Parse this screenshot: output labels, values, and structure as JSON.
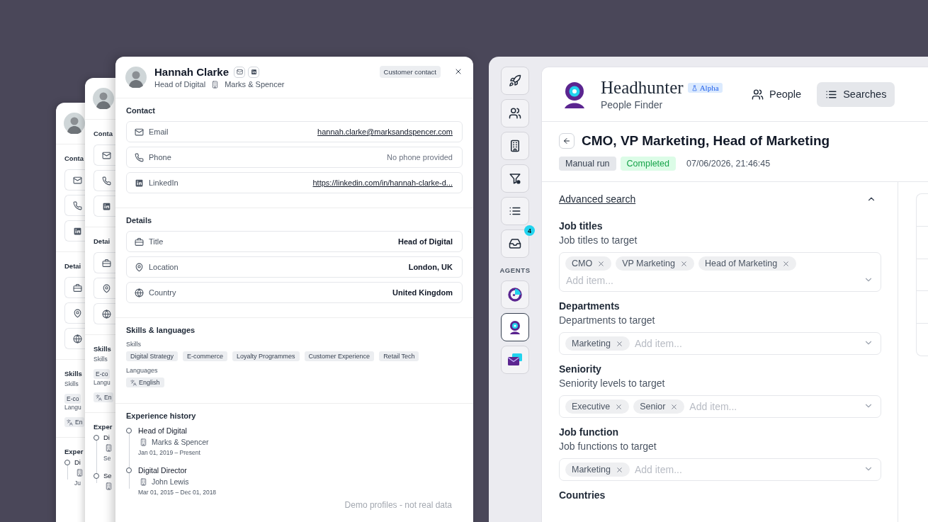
{
  "stacked_profiles": [
    {
      "contact_heading": "Conta",
      "details_heading": "Detai",
      "skills_heading": "Skills",
      "skills_label": "Skills",
      "skill": "E-co",
      "languages_label": "Langu",
      "language": "En",
      "experience_heading": "Exper",
      "experience": [
        {
          "title": "Di",
          "dates": "Ju"
        }
      ]
    },
    {
      "contact_heading": "Conta",
      "details_heading": "Detai",
      "skills_heading": "Skills",
      "skills_label": "Skills",
      "skill": "E-co",
      "languages_label": "Langu",
      "language": "En",
      "experience_heading": "Exper",
      "experience": [
        {
          "title": "Di",
          "dates": "Se"
        },
        {
          "title": "Se"
        }
      ]
    }
  ],
  "profile": {
    "name": "Hannah Clarke",
    "title": "Head of Digital",
    "company": "Marks & Spencer",
    "badge": "Customer contact",
    "sections": [
      {
        "heading": "Contact",
        "rows": [
          {
            "label": "Email",
            "value": "hannah.clarke@marksandspencer.com",
            "kind": "link"
          },
          {
            "label": "Phone",
            "value": "No phone provided",
            "kind": "empty"
          },
          {
            "label": "LinkedIn",
            "value": "https://linkedin.com/in/hannah-clarke-d...",
            "kind": "link"
          }
        ]
      },
      {
        "heading": "Details",
        "rows": [
          {
            "label": "Title",
            "value": "Head of Digital",
            "kind": "text"
          },
          {
            "label": "Location",
            "value": "London, UK",
            "kind": "text"
          },
          {
            "label": "Country",
            "value": "United Kingdom",
            "kind": "text"
          }
        ]
      }
    ],
    "skills": {
      "heading": "Skills & languages",
      "skills_label": "Skills",
      "skills": [
        "Digital Strategy",
        "E-commerce",
        "Loyalty Programmes",
        "Customer Experience",
        "Retail Tech"
      ],
      "languages_label": "Languages",
      "languages": [
        "English"
      ]
    },
    "experience": {
      "heading": "Experience history",
      "items": [
        {
          "title": "Head of Digital",
          "company": "Marks & Spencer",
          "dates": "Jan 01, 2019 – Present"
        },
        {
          "title": "Digital Director",
          "company": "John Lewis",
          "dates": "Mar 01, 2015 – Dec 01, 2018"
        }
      ]
    },
    "footnote": "Demo profiles - not real data"
  },
  "app": {
    "rail": {
      "tools": [
        {
          "selected": false
        },
        {
          "selected": false
        },
        {
          "selected": false
        },
        {
          "selected": false
        },
        {
          "selected": false
        },
        {
          "selected": false,
          "badge": "4"
        }
      ],
      "agents_label": "AGENTS",
      "agents": [
        {
          "selected": false
        },
        {
          "selected": true
        },
        {
          "selected": false
        }
      ]
    },
    "brand": {
      "name": "Headhunter",
      "badge": "Alpha",
      "subtitle": "People Finder"
    },
    "nav": [
      {
        "label": "People",
        "selected": false
      },
      {
        "label": "Searches",
        "selected": true
      }
    ],
    "search": {
      "title": "CMO, VP Marketing, Head of Marketing",
      "tags": [
        {
          "label": "Manual run",
          "kind": "neutral"
        },
        {
          "label": "Completed",
          "kind": "success"
        }
      ],
      "timestamp": "07/06/2026, 21:46:45"
    },
    "advanced_search": {
      "label": "Advanced search",
      "expanded": true,
      "fields": [
        {
          "label": "Job titles",
          "hint": "Job titles to target",
          "chips": [
            "CMO",
            "VP Marketing",
            "Head of Marketing"
          ],
          "placeholder": "Add item..."
        },
        {
          "label": "Departments",
          "hint": "Departments to target",
          "chips": [
            "Marketing"
          ],
          "placeholder": "Add item..."
        },
        {
          "label": "Seniority",
          "hint": "Seniority levels to target",
          "chips": [
            "Executive",
            "Senior"
          ],
          "placeholder": "Add item..."
        },
        {
          "label": "Job function",
          "hint": "Job functions to target",
          "chips": [
            "Marketing"
          ],
          "placeholder": "Add item..."
        },
        {
          "label": "Countries"
        }
      ]
    }
  }
}
